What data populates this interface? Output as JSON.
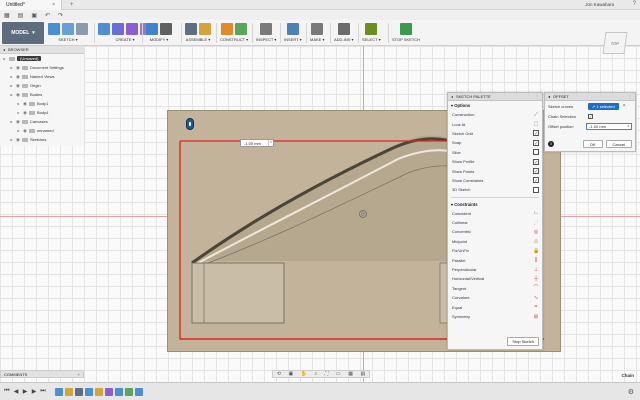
{
  "titlebar": {
    "tab_title": "Untitled*",
    "tab_close": "×",
    "user": "Jon Kawahara"
  },
  "ribbon": {
    "workspace": "MODEL",
    "groups": [
      {
        "label": "SKETCH ▾",
        "icons": [
          "#4a8fd6",
          "#66a0db",
          "#8a9bb0"
        ]
      },
      {
        "label": "CREATE ▾",
        "icons": [
          "#4f8fd0",
          "#6d6dd8",
          "#8b5fd3",
          "#9a78c9"
        ]
      },
      {
        "label": "MODIFY ▾",
        "icons": [
          "#3f84cf",
          "#606060"
        ]
      },
      {
        "label": "ASSEMBLE ▾",
        "icons": [
          "#5e6e83",
          "#d2a53b"
        ]
      },
      {
        "label": "CONSTRUCT ▾",
        "icons": [
          "#e08a2a",
          "#5ba45b"
        ]
      },
      {
        "label": "INSPECT ▾",
        "icons": [
          "#7a7a7a"
        ]
      },
      {
        "label": "INSERT ▾",
        "icons": [
          "#4e7fb8"
        ]
      },
      {
        "label": "MAKE ▾",
        "icons": [
          "#7a7a7a"
        ]
      },
      {
        "label": "ADD-INS ▾",
        "icons": [
          "#6b6b6b"
        ]
      },
      {
        "label": "SELECT ▾",
        "icons": [
          "#6b8e23"
        ]
      },
      {
        "label": "STOP SKETCH",
        "icons": [
          "#3c9a4f"
        ]
      }
    ]
  },
  "browser": {
    "title": "BROWSER",
    "items": [
      {
        "label": "(Unsaved)",
        "indent": 0,
        "active": true
      },
      {
        "label": "Document Settings",
        "indent": 1,
        "active": false
      },
      {
        "label": "Named Views",
        "indent": 1,
        "active": false
      },
      {
        "label": "Origin",
        "indent": 1,
        "active": false
      },
      {
        "label": "Bodies",
        "indent": 1,
        "active": false
      },
      {
        "label": "Body1",
        "indent": 2,
        "active": false
      },
      {
        "label": "Body4",
        "indent": 2,
        "active": false
      },
      {
        "label": "Canvases",
        "indent": 1,
        "active": false
      },
      {
        "label": "unnamed",
        "indent": 2,
        "active": false
      },
      {
        "label": "Sketches",
        "indent": 1,
        "active": false
      }
    ]
  },
  "comments": {
    "title": "COMMENTS",
    "plus": "+"
  },
  "dimension": {
    "value": "-1.00 mm"
  },
  "palette": {
    "title": "SKETCH PALETTE",
    "options_label": "Options",
    "options": [
      {
        "label": "Construction",
        "val": "⟋",
        "checkbox": false
      },
      {
        "label": "Look At",
        "val": "⬚",
        "checkbox": false
      },
      {
        "label": "Sketch Grid",
        "val": "✓",
        "checkbox": true
      },
      {
        "label": "Snap",
        "val": "✓",
        "checkbox": true
      },
      {
        "label": "Slice",
        "val": "",
        "checkbox": true
      },
      {
        "label": "Show Profile",
        "val": "✓",
        "checkbox": true
      },
      {
        "label": "Show Points",
        "val": "✓",
        "checkbox": true
      },
      {
        "label": "Show Constraints",
        "val": "✓",
        "checkbox": true
      },
      {
        "label": "3D Sketch",
        "val": "",
        "checkbox": true
      }
    ],
    "constraints_label": "Constraints",
    "constraints": [
      {
        "label": "Coincident",
        "val": "∟"
      },
      {
        "label": "Collinear",
        "val": "⋰"
      },
      {
        "label": "Concentric",
        "val": "◎"
      },
      {
        "label": "Midpoint",
        "val": "△"
      },
      {
        "label": "Fix/UnFix",
        "val": "🔒"
      },
      {
        "label": "Parallel",
        "val": "∥"
      },
      {
        "label": "Perpendicular",
        "val": "⊥"
      },
      {
        "label": "Horizontal/Vertical",
        "val": "┼"
      },
      {
        "label": "Tangent",
        "val": "⌒"
      },
      {
        "label": "Curvature",
        "val": "∿"
      },
      {
        "label": "Equal",
        "val": "="
      },
      {
        "label": "Symmetry",
        "val": "⊞"
      }
    ],
    "stop_button": "Stop Sketch"
  },
  "offset": {
    "title": "OFFSET",
    "sketch_curves_label": "Sketch curves",
    "selected": "1 selected",
    "chain_selection_label": "Chain Selection",
    "offset_position_label": "Offset position",
    "offset_position_value": "-1.00 mm",
    "ok": "OK",
    "cancel": "Cancel"
  },
  "viewcube": {
    "face": "TOP"
  },
  "status": {
    "chain": "Chain"
  },
  "colors": {
    "sheet": "#c2b39a",
    "sketch_red": "#e0261f",
    "selected_blue": "#1e6fc4"
  }
}
